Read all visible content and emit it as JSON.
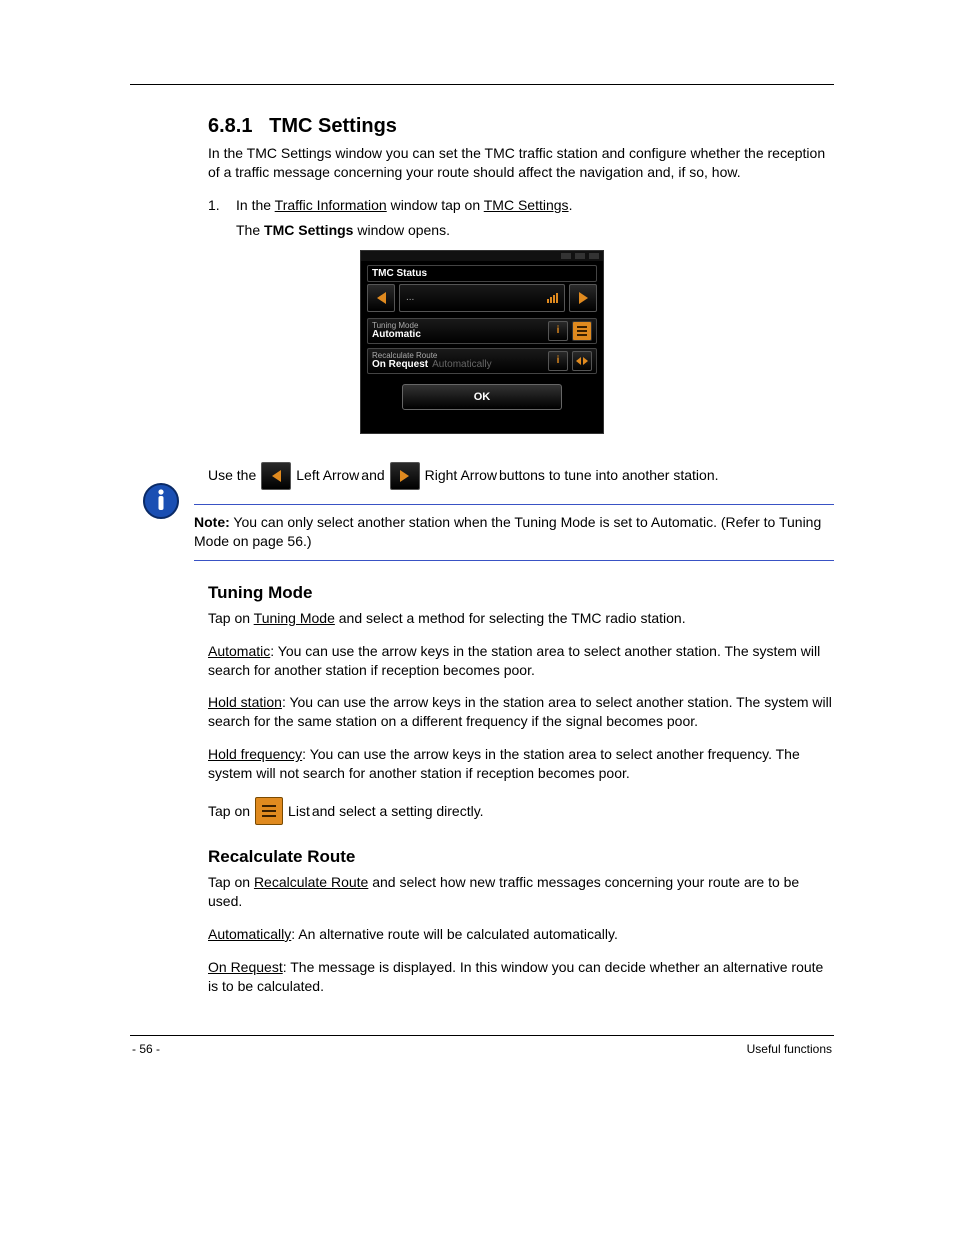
{
  "section": {
    "number": "6.8.1",
    "title": "TMC Settings",
    "intro": "In the TMC Settings window you can set the TMC traffic station and configure whether the reception of a traffic message concerning your route should affect the navigation and, if so, how.",
    "steps": {
      "s1_num": "1.",
      "s1_text_a": "In the ",
      "s1_text_b": "Traffic Information",
      "s1_text_c": " window tap on ",
      "s1_text_d": "TMC Settings",
      "s1_text_e": ".",
      "open_line_a": "The ",
      "open_line_b": "TMC Settings",
      "open_line_c": " window opens."
    },
    "tuning": {
      "title": "Tuning Mode",
      "p1_a": "Tap on ",
      "p1_b": "Tuning Mode",
      "p1_c": " and select a method for selecting the TMC radio station.",
      "auto_a": "Automatic",
      "auto_b": ": You can use the arrow keys in the station area to select another station. The system will search for another station if reception becomes poor.",
      "hold_a": "Hold station",
      "hold_b": ": You can use the arrow keys in the station area to select another station. The system will search for the same station on a different frequency if the signal becomes poor.",
      "freq_a": "Hold frequency",
      "freq_b": ": You can use the arrow keys in the station area to select another frequency. The system will not search for another station if reception becomes poor."
    },
    "recalc": {
      "title": "Recalculate Route",
      "p1_a": "Tap on ",
      "p1_b": "Recalculate Route",
      "p1_c": " and select how new traffic messages concerning your route are to be used.",
      "auto_a": "Automatically",
      "auto_b": ": An alternative route will be calculated automatically.",
      "req_a": "On Request",
      "req_b": ": The message is displayed. In this window you can decide whether an alternative route is to be calculated."
    },
    "note_a": "Note:",
    "note_b": " You can only select another station when the Tuning Mode is set to Automatic. (Refer to ",
    "note_c": "Tuning Mode",
    "note_d": " on page ",
    "note_e": "56",
    "note_f": ".)",
    "arrows_a": "Use the ",
    "arrows_b": "Left Arrow",
    "arrows_c": " and ",
    "arrows_d": "Right Arrow",
    "arrows_e": " buttons to tune into another station.",
    "list_a": "Tap on ",
    "list_b": "List",
    "list_c": " and select a setting directly."
  },
  "device": {
    "tmc_status": "TMC Status",
    "mid_text": "...",
    "tuning_label": "Tuning Mode",
    "tuning_value": "Automatic",
    "recalc_label": "Recalculate Route",
    "recalc_value": "On Request",
    "recalc_alt": "Automatically",
    "info_char": "i",
    "ok": "OK"
  },
  "footer": {
    "left": "- 56 -",
    "right": "Useful functions"
  }
}
